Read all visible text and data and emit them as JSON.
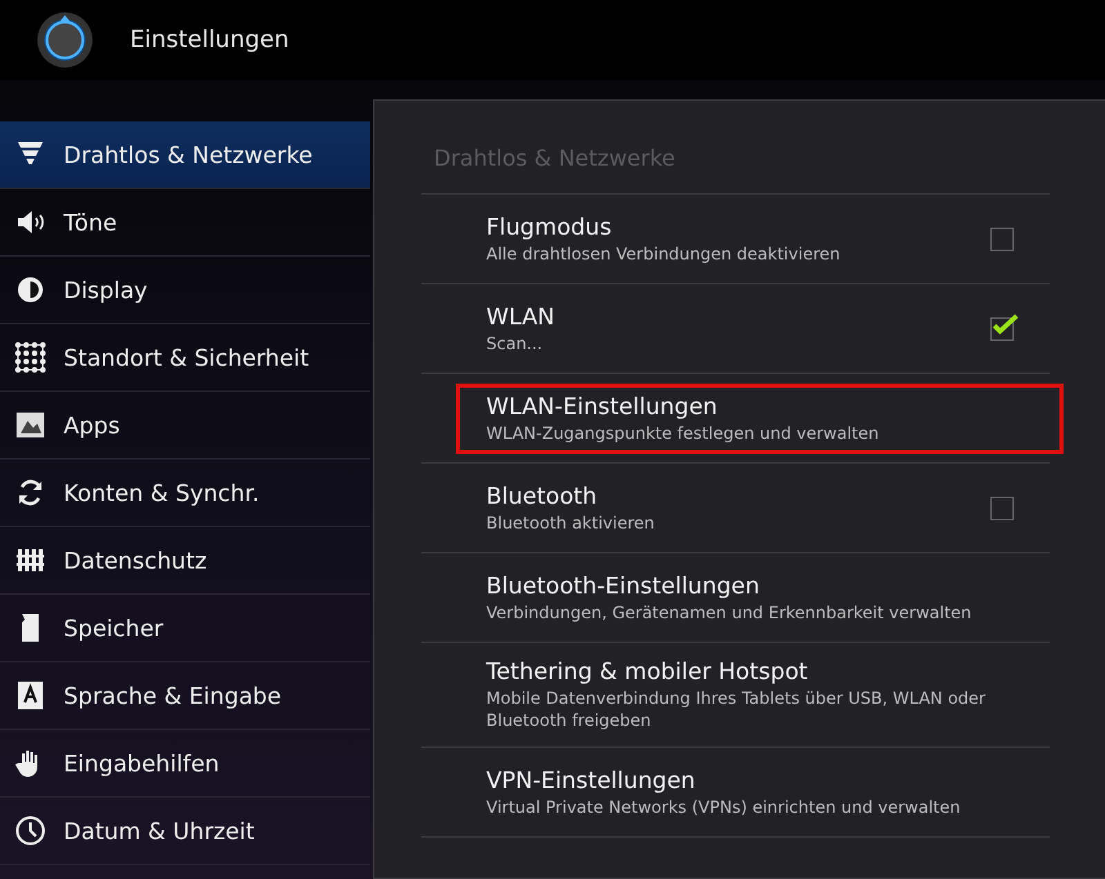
{
  "app_bar": {
    "title": "Einstellungen"
  },
  "sidebar": {
    "items": [
      {
        "label": "Drahtlos & Netzwerke",
        "selected": true
      },
      {
        "label": "Töne",
        "selected": false
      },
      {
        "label": "Display",
        "selected": false
      },
      {
        "label": "Standort & Sicherheit",
        "selected": false
      },
      {
        "label": "Apps",
        "selected": false
      },
      {
        "label": "Konten & Synchr.",
        "selected": false
      },
      {
        "label": "Datenschutz",
        "selected": false
      },
      {
        "label": "Speicher",
        "selected": false
      },
      {
        "label": "Sprache & Eingabe",
        "selected": false
      },
      {
        "label": "Eingabehilfen",
        "selected": false
      },
      {
        "label": "Datum & Uhrzeit",
        "selected": false
      }
    ]
  },
  "panel": {
    "header": "Drahtlos & Netzwerke",
    "items": [
      {
        "kind": "checkbox",
        "title": "Flugmodus",
        "summary": "Alle drahtlosen Verbindungen deaktivieren",
        "checked": false,
        "highlighted": false
      },
      {
        "kind": "checkbox",
        "title": "WLAN",
        "summary": "Scan...",
        "checked": true,
        "highlighted": false
      },
      {
        "kind": "link",
        "title": "WLAN-Einstellungen",
        "summary": "WLAN-Zugangspunkte festlegen und verwalten",
        "highlighted": true
      },
      {
        "kind": "checkbox",
        "title": "Bluetooth",
        "summary": "Bluetooth aktivieren",
        "checked": false,
        "highlighted": false
      },
      {
        "kind": "link",
        "title": "Bluetooth-Einstellungen",
        "summary": "Verbindungen, Gerätenamen und Erkennbarkeit verwalten",
        "highlighted": false
      },
      {
        "kind": "link",
        "title": "Tethering & mobiler Hotspot",
        "summary": "Mobile Datenverbindung Ihres Tablets über USB, WLAN oder Bluetooth freigeben",
        "highlighted": false
      },
      {
        "kind": "link",
        "title": "VPN-Einstellungen",
        "summary": "Virtual Private Networks (VPNs) einrichten und verwalten",
        "highlighted": false
      }
    ]
  }
}
